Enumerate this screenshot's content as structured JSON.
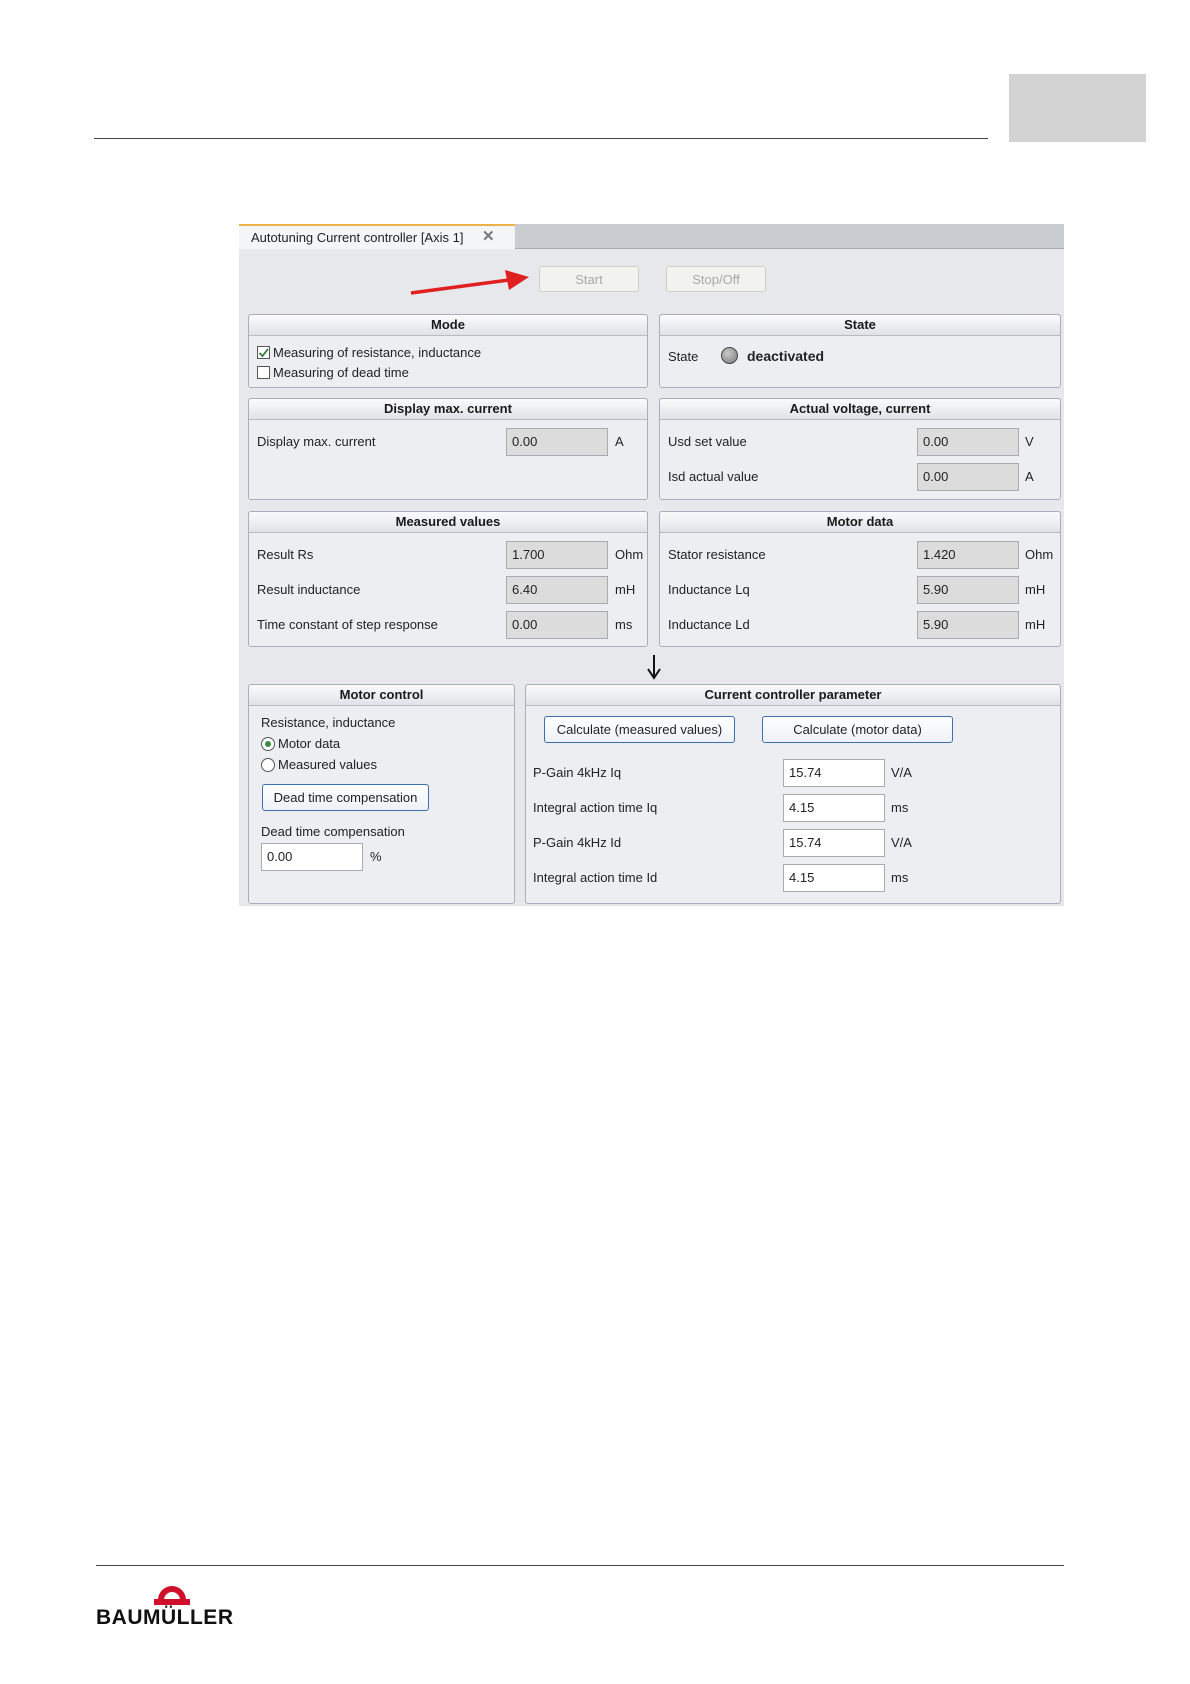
{
  "window": {
    "tab_title": "Autotuning Current controller [Axis 1]",
    "start_label": "Start",
    "stop_label": "Stop/Off"
  },
  "mode": {
    "title": "Mode",
    "options": [
      {
        "label": "Measuring of resistance, inductance",
        "checked": true
      },
      {
        "label": "Measuring of dead time",
        "checked": false
      }
    ]
  },
  "state": {
    "title": "State",
    "label": "State",
    "value": "deactivated"
  },
  "display_max_current": {
    "title": "Display max. current",
    "label": "Display max. current",
    "value": "0.00",
    "unit": "A"
  },
  "actual_voltage_current": {
    "title": "Actual voltage, current",
    "rows": [
      {
        "label": "Usd set value",
        "value": "0.00",
        "unit": "V"
      },
      {
        "label": "Isd actual value",
        "value": "0.00",
        "unit": "A"
      }
    ]
  },
  "measured_values": {
    "title": "Measured values",
    "rows": [
      {
        "label": "Result Rs",
        "value": "1.700",
        "unit": "Ohm"
      },
      {
        "label": "Result inductance",
        "value": "6.40",
        "unit": "mH"
      },
      {
        "label": "Time constant of step response",
        "value": "0.00",
        "unit": "ms"
      }
    ]
  },
  "motor_data": {
    "title": "Motor data",
    "rows": [
      {
        "label": "Stator resistance",
        "value": "1.420",
        "unit": "Ohm"
      },
      {
        "label": "Inductance Lq",
        "value": "5.90",
        "unit": "mH"
      },
      {
        "label": "Inductance Ld",
        "value": "5.90",
        "unit": "mH"
      }
    ]
  },
  "motor_control": {
    "title": "Motor control",
    "group_label": "Resistance, inductance",
    "radio_motor_data": "Motor data",
    "radio_measured_values": "Measured values",
    "selected": "Motor data",
    "dead_time_button": "Dead time compensation",
    "dead_time_label": "Dead time compensation",
    "dead_time_value": "0.00",
    "dead_time_unit": "%"
  },
  "current_controller": {
    "title": "Current controller parameter",
    "calc_measured_label": "Calculate (measured values)",
    "calc_motor_label": "Calculate (motor data)",
    "rows": [
      {
        "label": "P-Gain 4kHz Iq",
        "value": "15.74",
        "unit": "V/A"
      },
      {
        "label": "Integral action time Iq",
        "value": "4.15",
        "unit": "ms"
      },
      {
        "label": "P-Gain 4kHz Id",
        "value": "15.74",
        "unit": "V/A"
      },
      {
        "label": "Integral action time Id",
        "value": "4.15",
        "unit": "ms"
      }
    ]
  },
  "footer": {
    "logo_text": "BAUMÜLLER"
  },
  "colors": {
    "arrow": "#e02020",
    "tab_accent": "#e9b34a",
    "button_border": "#3b6fb0"
  }
}
